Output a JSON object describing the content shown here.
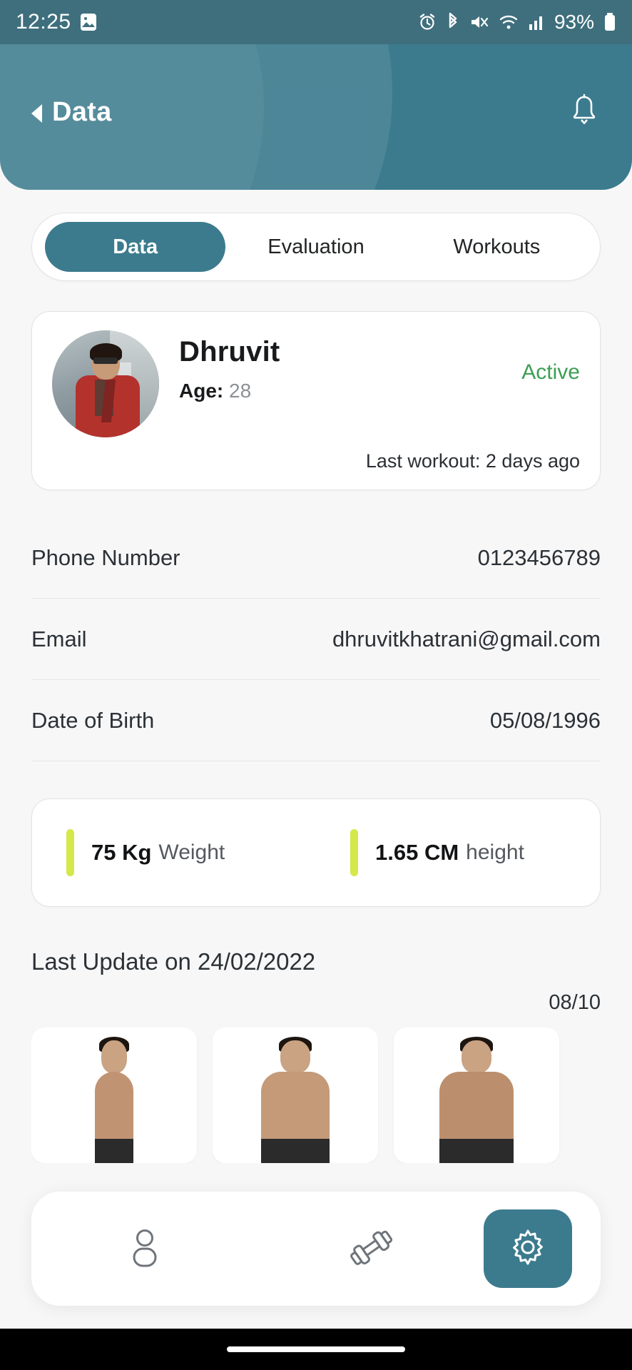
{
  "status_bar": {
    "time": "12:25",
    "battery": "93%",
    "icons": [
      "image-icon",
      "alarm-icon",
      "bluetooth-icon",
      "mute-icon",
      "wifi-icon",
      "signal-icon",
      "battery-icon"
    ]
  },
  "header": {
    "title": "Data",
    "back_icon": "back-arrow-icon",
    "notification_icon": "bell-icon",
    "background_color": "#3c7b8e"
  },
  "tabs": [
    {
      "label": "Data",
      "active": true
    },
    {
      "label": "Evaluation",
      "active": false
    },
    {
      "label": "Workouts",
      "active": false
    }
  ],
  "profile": {
    "avatar": "user-photo",
    "name": "Dhruvit",
    "age_label": "Age:",
    "age_value": "28",
    "status": "Active",
    "status_color": "#3d9e54",
    "last_workout": "Last workout: 2 days ago"
  },
  "info_rows": [
    {
      "label": "Phone Number",
      "value": "0123456789"
    },
    {
      "label": "Email",
      "value": "dhruvitkhatrani@gmail.com"
    },
    {
      "label": "Date of Birth",
      "value": "05/08/1996"
    }
  ],
  "metrics": {
    "accent_color": "#d4e84a",
    "weight": {
      "value": "75 Kg",
      "unit": "Weight"
    },
    "height": {
      "value": "1.65 CM",
      "unit": "height"
    }
  },
  "last_update": {
    "text": "Last Update on 24/02/2022",
    "photo_counter": "08/10",
    "photos": [
      "side-view-photo",
      "front-view-photo",
      "back-view-photo"
    ]
  },
  "bottom_nav": [
    {
      "icon": "person-icon",
      "active": false
    },
    {
      "icon": "dumbbell-icon",
      "active": false
    },
    {
      "icon": "gear-icon",
      "active": true
    }
  ]
}
